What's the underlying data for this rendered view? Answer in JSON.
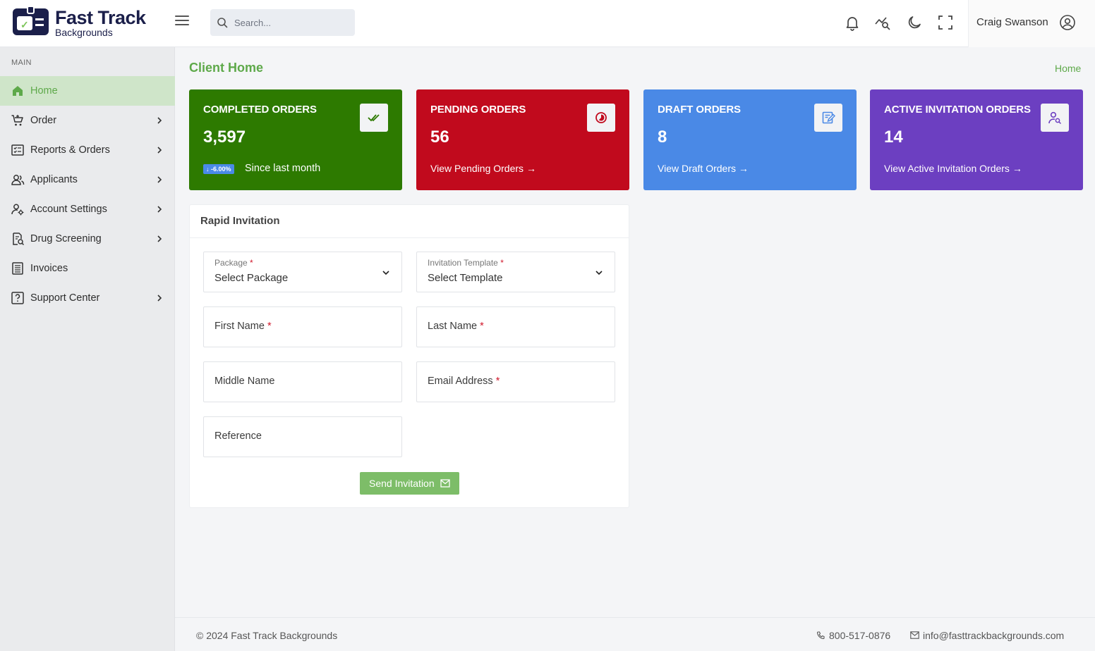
{
  "brand": {
    "name": "Fast Track",
    "tagline": "Backgrounds"
  },
  "search": {
    "placeholder": "Search..."
  },
  "header": {
    "icons": [
      "bell-icon",
      "analytics-search-icon",
      "moon-icon",
      "fullscreen-icon"
    ],
    "user_name": "Craig Swanson"
  },
  "sidebar": {
    "section_label": "MAIN",
    "items": [
      {
        "label": "Home",
        "icon": "home-icon",
        "active": true,
        "has_submenu": false
      },
      {
        "label": "Order",
        "icon": "cart-icon",
        "active": false,
        "has_submenu": true
      },
      {
        "label": "Reports & Orders",
        "icon": "report-icon",
        "active": false,
        "has_submenu": true
      },
      {
        "label": "Applicants",
        "icon": "users-icon",
        "active": false,
        "has_submenu": true
      },
      {
        "label": "Account Settings",
        "icon": "user-settings-icon",
        "active": false,
        "has_submenu": true
      },
      {
        "label": "Drug Screening",
        "icon": "drug-screening-icon",
        "active": false,
        "has_submenu": true
      },
      {
        "label": "Invoices",
        "icon": "invoice-icon",
        "active": false,
        "has_submenu": false
      },
      {
        "label": "Support Center",
        "icon": "help-icon",
        "active": false,
        "has_submenu": true
      }
    ]
  },
  "page": {
    "title": "Client Home",
    "breadcrumb": "Home"
  },
  "stats": [
    {
      "title": "COMPLETED ORDERS",
      "value": "3,597",
      "badge": "↓ -6.00%",
      "subtext": "Since last month",
      "color": "#2d7a00",
      "icon": "double-check-icon"
    },
    {
      "title": "PENDING ORDERS",
      "value": "56",
      "link": "View Pending Orders",
      "color": "#c10a1d",
      "icon": "pending-icon"
    },
    {
      "title": "DRAFT ORDERS",
      "value": "8",
      "link": "View Draft Orders",
      "color": "#4a89e6",
      "icon": "edit-note-icon"
    },
    {
      "title": "ACTIVE INVITATION ORDERS",
      "value": "14",
      "link": "View Active Invitation Orders",
      "color": "#6c3fc1",
      "icon": "user-search-icon"
    }
  ],
  "rapid_invitation": {
    "title": "Rapid Invitation",
    "package": {
      "label": "Package",
      "value": "Select Package"
    },
    "template": {
      "label": "Invitation Template",
      "value": "Select Template"
    },
    "first_name": "First Name",
    "last_name": "Last Name",
    "middle_name": "Middle Name",
    "email": "Email Address",
    "reference": "Reference",
    "send_label": "Send Invitation"
  },
  "footer": {
    "copyright": "© 2024 Fast Track Backgrounds",
    "phone": "800-517-0876",
    "email": "info@fasttrackbackgrounds.com"
  },
  "colors": {
    "accent": "#5ea94a",
    "button": "#7dbd68",
    "required": "#d0182b",
    "brand_navy": "#1b1f4a"
  }
}
